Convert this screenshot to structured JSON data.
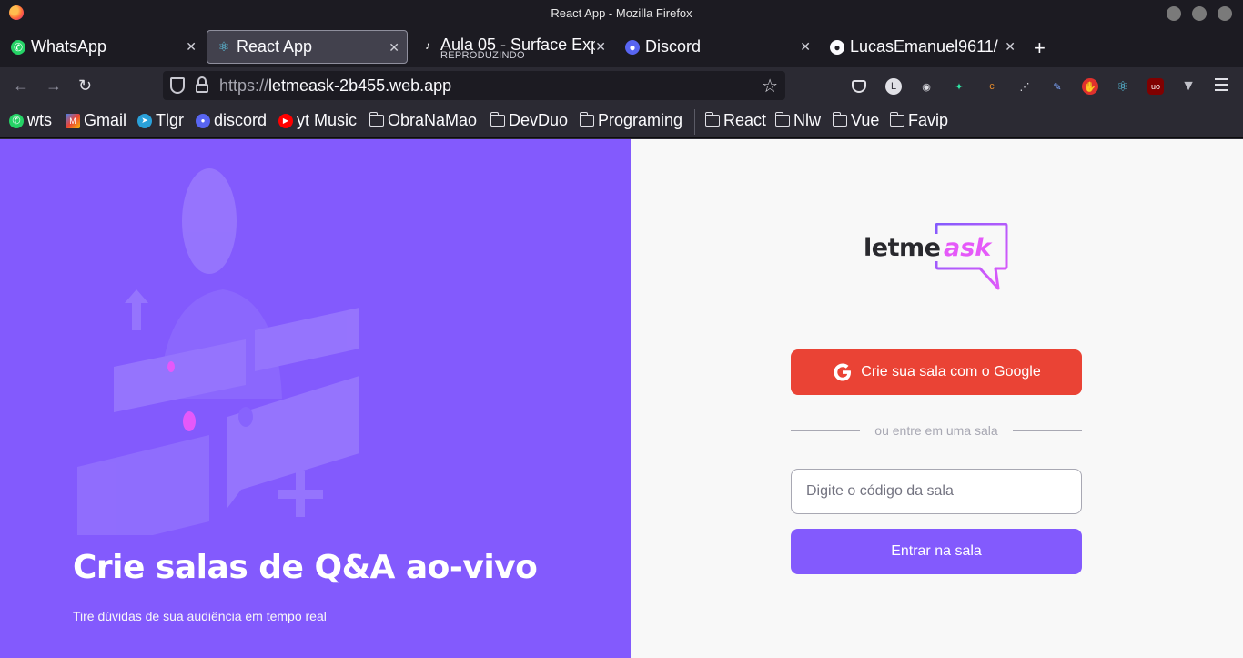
{
  "window": {
    "title": "React App - Mozilla Firefox"
  },
  "tabs": [
    {
      "label": "WhatsApp",
      "icon": "whatsapp-icon"
    },
    {
      "label": "React App",
      "icon": "react-icon",
      "active": true
    },
    {
      "label": "Aula 05 - Surface Exp",
      "sublabel": "REPRODUZINDO",
      "icon": "music-icon"
    },
    {
      "label": "Discord",
      "icon": "discord-icon"
    },
    {
      "label": "LucasEmanuel9611/",
      "icon": "github-icon"
    }
  ],
  "navbar": {
    "url_scheme": "https://",
    "url_host": "letmeask-2b455.web.app"
  },
  "bookmarks": [
    {
      "label": "wts",
      "icon": "whatsapp-icon"
    },
    {
      "label": "Gmail",
      "icon": "gmail-icon"
    },
    {
      "label": "Tlgr",
      "icon": "telegram-icon"
    },
    {
      "label": "discord",
      "icon": "discord-icon"
    },
    {
      "label": "yt Music",
      "icon": "youtube-music-icon"
    },
    {
      "label": "ObraNaMao",
      "icon": "folder-icon"
    },
    {
      "label": "DevDuo",
      "icon": "folder-icon"
    },
    {
      "label": "Programing",
      "icon": "folder-icon"
    },
    {
      "label": "React",
      "icon": "folder-icon"
    },
    {
      "label": "Nlw",
      "icon": "folder-icon"
    },
    {
      "label": "Vue",
      "icon": "folder-icon"
    },
    {
      "label": "Favip",
      "icon": "folder-icon"
    }
  ],
  "aside": {
    "headline": "Crie salas de Q&A ao-vivo",
    "tagline": "Tire dúvidas de sua audiência em tempo real"
  },
  "main": {
    "logo_letme": "letme",
    "logo_ask": "ask",
    "google_button": "Crie sua sala com o Google",
    "separator": "ou entre em uma sala",
    "room_input_placeholder": "Digite o código da sala",
    "enter_button": "Entrar na sala"
  },
  "colors": {
    "brand_purple": "#835afd",
    "google_red": "#ea4335",
    "logo_pink": "#e559f9"
  }
}
